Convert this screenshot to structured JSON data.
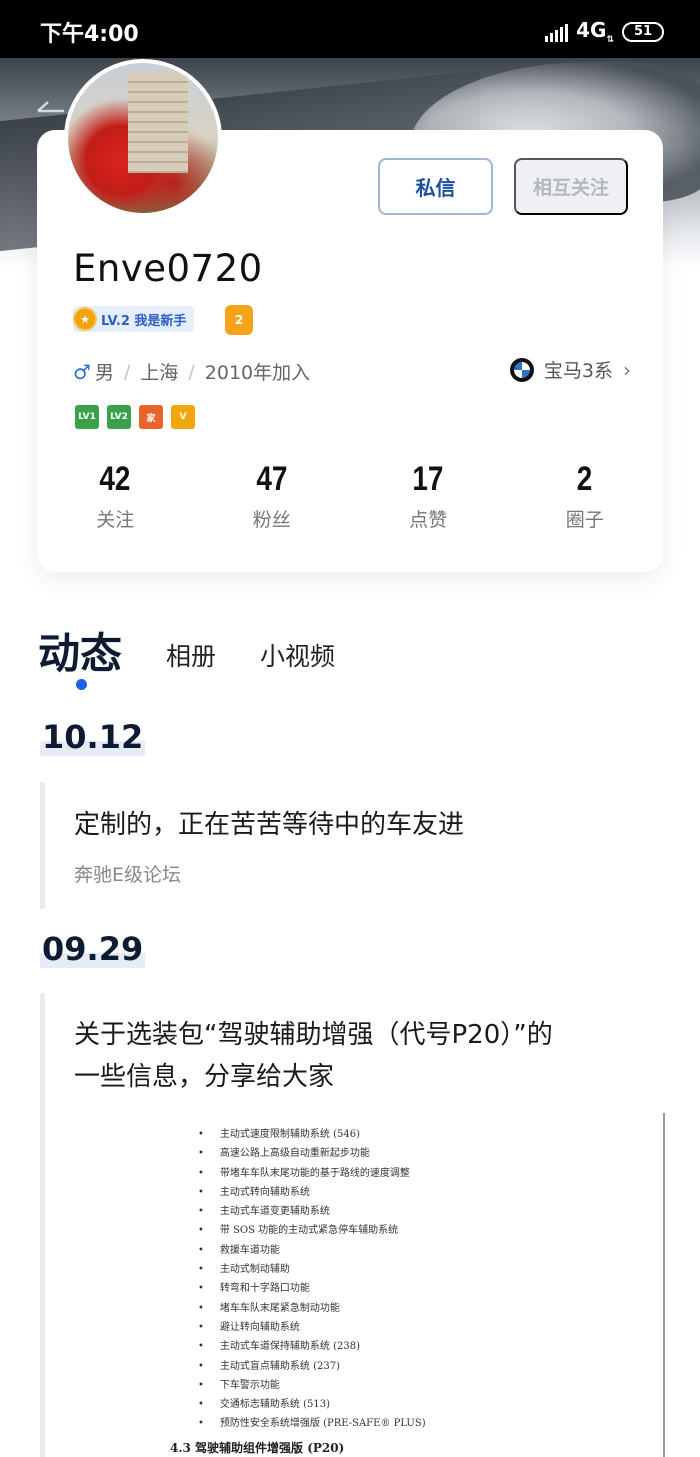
{
  "status_bar": {
    "time": "下午4:00",
    "network": "4G",
    "battery": "51"
  },
  "profile": {
    "username": "Enve0720",
    "level_badge": "LV.2 我是新手",
    "car_badge": "2",
    "gender_symbol": "♂",
    "gender": "男",
    "city": "上海",
    "joined": "2010年加入",
    "car_model": "宝马3系",
    "buttons": {
      "message": "私信",
      "follow": "相互关注"
    },
    "tags": [
      {
        "label": "LV1",
        "color": "#3aa14a"
      },
      {
        "label": "LV2",
        "color": "#3aa14a"
      },
      {
        "label": "家",
        "color": "#e9642a"
      },
      {
        "label": "V",
        "color": "#f2a80c"
      }
    ],
    "stats": [
      {
        "value": "42",
        "label": "关注"
      },
      {
        "value": "47",
        "label": "粉丝"
      },
      {
        "value": "17",
        "label": "点赞"
      },
      {
        "value": "2",
        "label": "圈子"
      }
    ]
  },
  "tabs": {
    "active": "动态",
    "items": [
      "相册",
      "小视频"
    ]
  },
  "feed": [
    {
      "date": "10.12",
      "title": "定制的，正在苦苦等待中的车友进",
      "forum": "奔驰E级论坛"
    },
    {
      "date": "09.29",
      "title_line1": "关于选装包“驾驶辅助增强（代号P20）”的",
      "title_line2": "一些信息，分享给大家"
    }
  ],
  "document_image": {
    "items": [
      "主动式速度限制辅助系统 (546)",
      "高速公路上高级自动重新起步功能",
      "带堵车车队末尾功能的基于路线的速度调整",
      "主动式转向辅助系统",
      "主动式车道变更辅助系统",
      "带 SOS 功能的主动式紧急停车辅助系统",
      "救援车道功能",
      "主动式制动辅助",
      "转弯和十字路口功能",
      "堵车车队末尾紧急制动功能",
      "避让转向辅助系统",
      "主动式车道保持辅助系统 (238)",
      "主动式盲点辅助系统 (237)",
      "下车警示功能",
      "交通标志辅助系统 (513)",
      "预防性安全系统增强版 (PRE-SAFE® PLUS)"
    ],
    "heading": "4.3   驾驶辅助组件增强版 (P20)"
  },
  "colors": {
    "accent": "#1f5ee8",
    "primary_text": "#0d1b33",
    "button_text": "#1d4fa3"
  }
}
